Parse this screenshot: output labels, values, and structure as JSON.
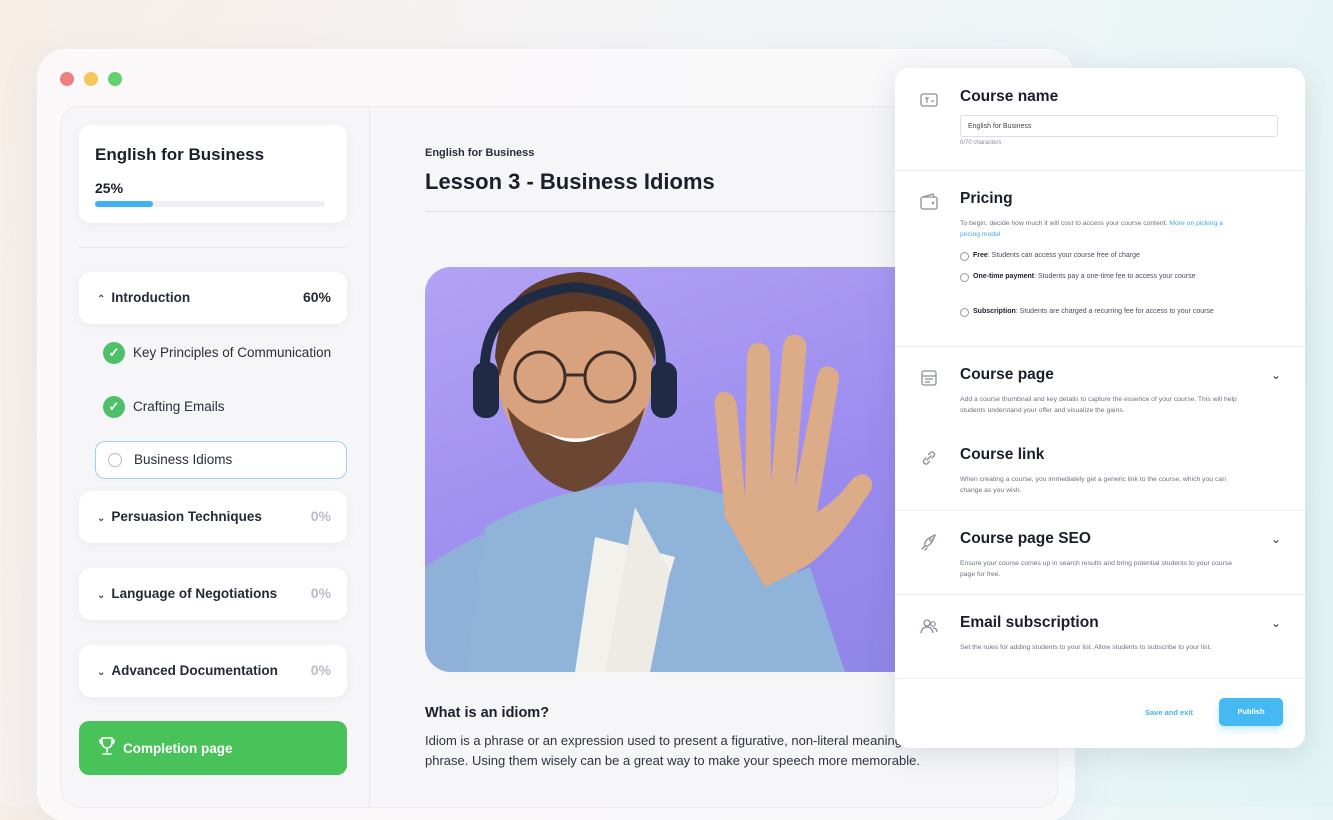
{
  "course": {
    "title": "English for Business",
    "progress_label": "25%",
    "progress": 0.25
  },
  "sections": [
    {
      "label": "Introduction",
      "pct": "60%",
      "expanded": true
    },
    {
      "label": "Persuasion Techniques",
      "pct": "0%",
      "expanded": false
    },
    {
      "label": "Language of Negotiations",
      "pct": "0%",
      "expanded": false
    },
    {
      "label": "Advanced Documentation",
      "pct": "0%",
      "expanded": false
    }
  ],
  "lessons": [
    {
      "label": "Key Principles of Communication",
      "completed": true
    },
    {
      "label": "Crafting Emails",
      "completed": true
    },
    {
      "label": "Business Idioms",
      "completed": false,
      "active": true
    }
  ],
  "completion": {
    "label": "Completion page"
  },
  "main": {
    "breadcrumb": "English for Business",
    "title": "Lesson 3 - Business Idioms",
    "question_title": "What is an idiom?",
    "question_body": "Idiom is a phrase or an expression used to present a figurative, non-literal meaning attached to the phrase. Using them wisely can be a great way to make your speech more memorable."
  },
  "panel": {
    "course_name": {
      "title": "Course name",
      "value": "English for Business",
      "hint": "0/70 characters"
    },
    "pricing": {
      "title": "Pricing",
      "desc": "To begin, decide how much it will cost to access your course content.",
      "link": "More on picking a pricing model",
      "options": [
        {
          "name": "Free",
          "text": ": Students can access your course free of charge"
        },
        {
          "name": "One-time payment",
          "text": ": Students pay a one-time fee to access your course"
        },
        {
          "name": "Subscription",
          "text": ": Students are charged a recurring fee for access to your course"
        }
      ]
    },
    "course_page": {
      "title": "Course page",
      "desc": "Add a course thumbnail and key details to capture the essence of your course. This will help students understand your offer and visualize the gains."
    },
    "course_link": {
      "title": "Course link",
      "desc": "When creating a course, you immediately get a generic link to the course, which you can change as you wish."
    },
    "course_seo": {
      "title": "Course page SEO",
      "desc": "Ensure your course comes up in search results and bring potential students to your course page for free."
    },
    "email_sub": {
      "title": "Email subscription",
      "desc": "Set the rules for adding students to your list. Allow students to subscribe to your list."
    },
    "save_label": "Save and exit",
    "publish_label": "Publish"
  },
  "colors": {
    "accent_blue": "#47b9f2",
    "success_green": "#49c25a",
    "photo_bg": "#9b8bef"
  }
}
